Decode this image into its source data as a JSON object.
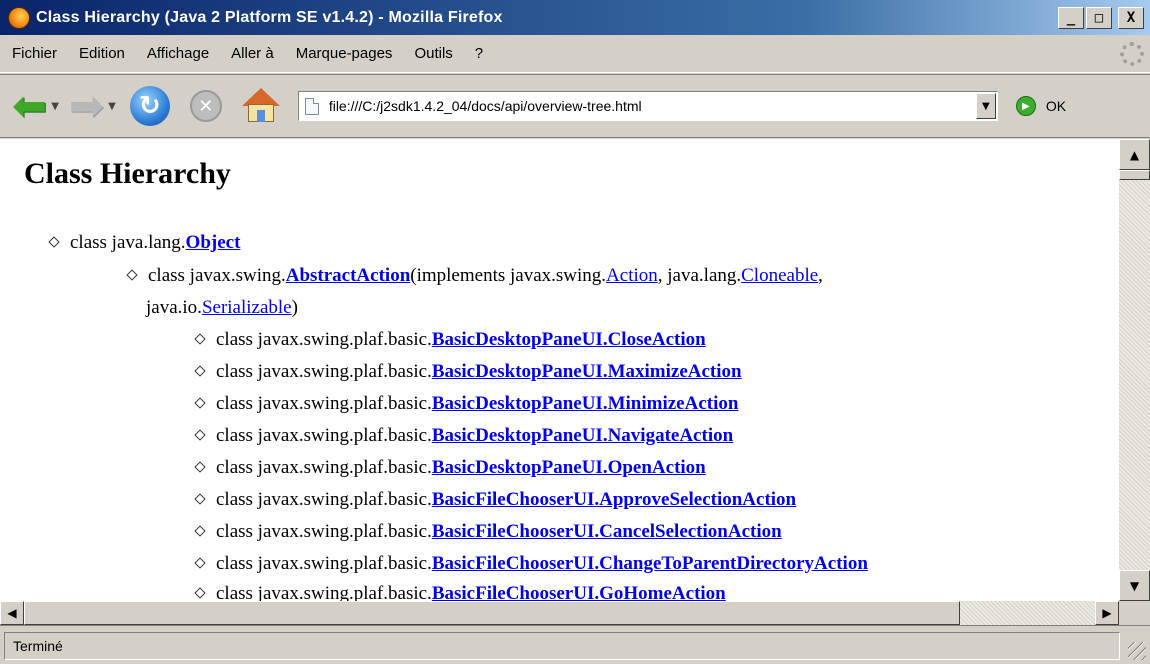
{
  "window": {
    "title": "Class Hierarchy (Java 2 Platform SE v1.4.2) - Mozilla Firefox",
    "buttons": {
      "minimize": "_",
      "maximize": "□",
      "close": "X"
    }
  },
  "menu": {
    "items": [
      "Fichier",
      "Edition",
      "Affichage",
      "Aller à",
      "Marque-pages",
      "Outils",
      "?"
    ]
  },
  "toolbar": {
    "back_icon": "back-arrow-icon",
    "forward_icon": "forward-arrow-icon",
    "url": "file:///C:/j2sdk1.4.2_04/docs/api/overview-tree.html",
    "go_label": "OK",
    "accent_green": "#3fa82a"
  },
  "content": {
    "page_title": "Class Hierarchy",
    "link_color": "#0000ee",
    "tree": [
      {
        "prefix": "class java.lang.",
        "link": "Object",
        "suffix": ""
      },
      {
        "prefix": "class javax.swing.",
        "link": "AbstractAction",
        "suffix": " (implements javax.swing.",
        "link2": "Action",
        "suffix2": ", java.lang.",
        "link3": "Cloneable",
        "suffix3": ","
      },
      {
        "prefix": "java.io.",
        "link": "Serializable",
        "suffix": ")"
      },
      {
        "prefix": "class javax.swing.plaf.basic.",
        "link": "BasicDesktopPaneUI.CloseAction"
      },
      {
        "prefix": "class javax.swing.plaf.basic.",
        "link": "BasicDesktopPaneUI.MaximizeAction"
      },
      {
        "prefix": "class javax.swing.plaf.basic.",
        "link": "BasicDesktopPaneUI.MinimizeAction"
      },
      {
        "prefix": "class javax.swing.plaf.basic.",
        "link": "BasicDesktopPaneUI.NavigateAction"
      },
      {
        "prefix": "class javax.swing.plaf.basic.",
        "link": "BasicDesktopPaneUI.OpenAction"
      },
      {
        "prefix": "class javax.swing.plaf.basic.",
        "link": "BasicFileChooserUI.ApproveSelectionAction"
      },
      {
        "prefix": "class javax.swing.plaf.basic.",
        "link": "BasicFileChooserUI.CancelSelectionAction"
      },
      {
        "prefix": "class javax.swing.plaf.basic.",
        "link": "BasicFileChooserUI.ChangeToParentDirectoryAction"
      },
      {
        "prefix": "class javax.swing.plaf.basic.",
        "link": "BasicFileChooserUI.GoHomeAction"
      }
    ]
  },
  "status": {
    "text": "Terminé"
  }
}
